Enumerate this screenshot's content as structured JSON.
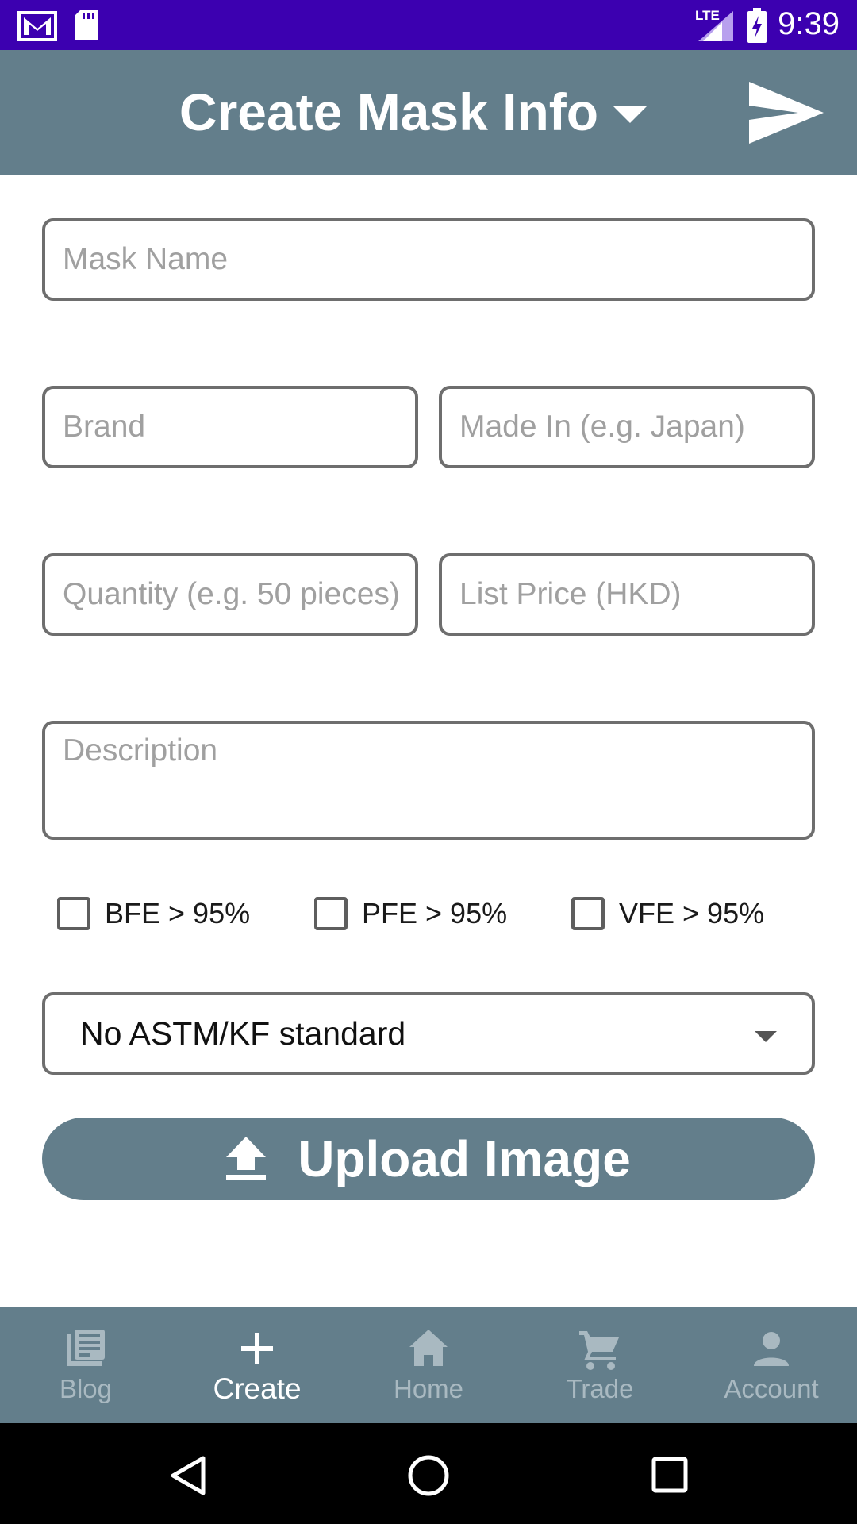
{
  "status_bar": {
    "time": "9:39",
    "network": "LTE",
    "icons": [
      "gmail-icon",
      "sd-card-icon",
      "signal-icon",
      "battery-charging-icon"
    ]
  },
  "app_bar": {
    "title": "Create Mask Info",
    "actions": [
      "dropdown-caret-icon",
      "send-icon"
    ]
  },
  "form": {
    "mask_name_placeholder": "Mask Name",
    "brand_placeholder": "Brand",
    "made_in_placeholder": "Made In (e.g. Japan)",
    "quantity_placeholder": "Quantity (e.g. 50 pieces)",
    "list_price_placeholder": "List Price (HKD)",
    "description_placeholder": "Description",
    "checkboxes": [
      {
        "label": "BFE > 95%",
        "checked": false
      },
      {
        "label": "PFE > 95%",
        "checked": false
      },
      {
        "label": "VFE > 95%",
        "checked": false
      }
    ],
    "standard_select": "No ASTM/KF standard",
    "upload_label": "Upload Image"
  },
  "bottom_nav": {
    "items": [
      {
        "label": "Blog",
        "icon": "newspaper-icon",
        "active": false
      },
      {
        "label": "Create",
        "icon": "plus-icon",
        "active": true
      },
      {
        "label": "Home",
        "icon": "home-icon",
        "active": false
      },
      {
        "label": "Trade",
        "icon": "cart-icon",
        "active": false
      },
      {
        "label": "Account",
        "icon": "person-icon",
        "active": false
      }
    ]
  },
  "colors": {
    "status_bar": "#3c00b0",
    "primary": "#637e8b",
    "inactive_nav": "#a9b9c1",
    "border": "#6e6e6e"
  }
}
